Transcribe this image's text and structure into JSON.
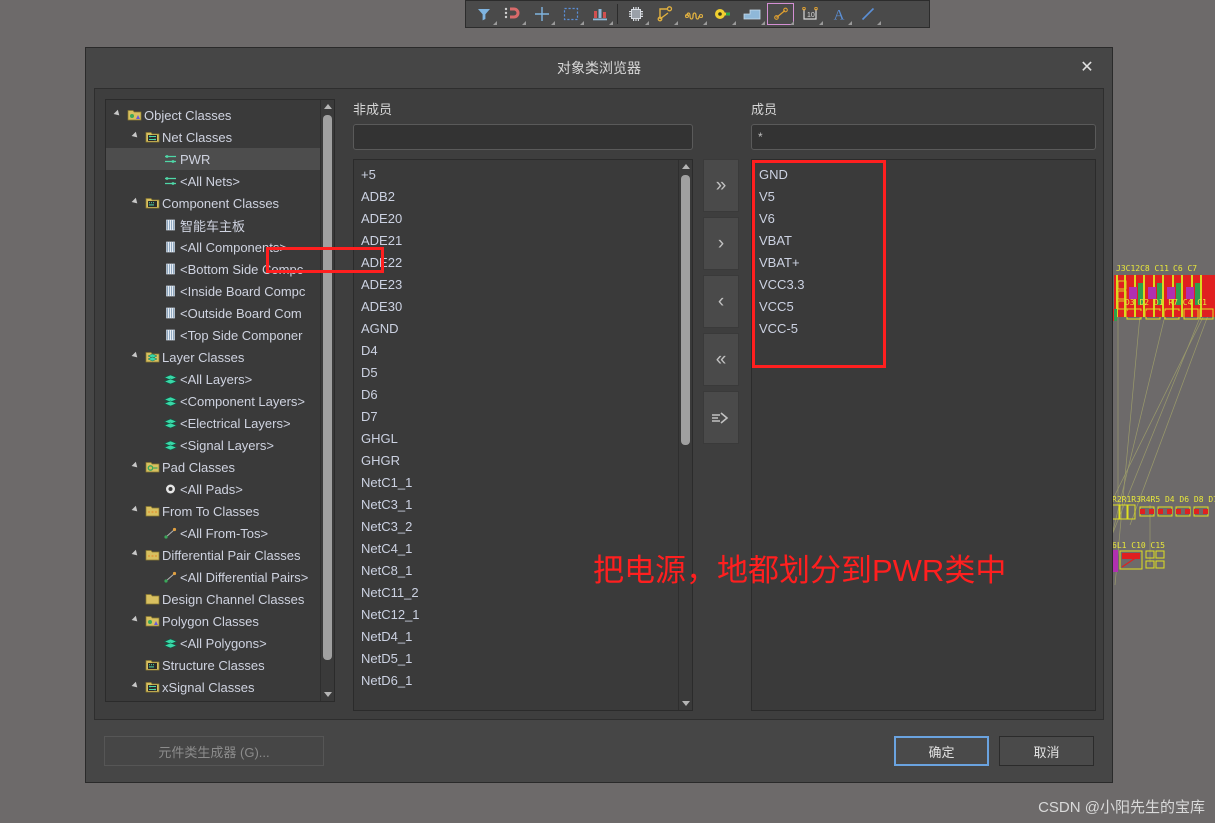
{
  "toolbar": {
    "items": [
      {
        "name": "filter-icon",
        "label": "Filter"
      },
      {
        "name": "magnet-icon",
        "label": "Snap"
      },
      {
        "name": "crosshair-icon",
        "label": "Origin"
      },
      {
        "name": "selection-rect-icon",
        "label": "Selection"
      },
      {
        "name": "board-planning-icon",
        "label": "Board Planning"
      },
      {
        "name": "component-chip-icon",
        "label": "Place Component"
      },
      {
        "name": "route-track-icon",
        "label": "Interactive Routing"
      },
      {
        "name": "squiggle-icon",
        "label": "Length Tuning"
      },
      {
        "name": "via-icon",
        "label": "Place Via"
      },
      {
        "name": "polygon-pour-icon",
        "label": "Polygon Pour"
      },
      {
        "name": "dimension-icon",
        "label": "Dimension"
      },
      {
        "name": "ruler-icon",
        "label": "Measure"
      },
      {
        "name": "text-icon",
        "label": "Place String"
      },
      {
        "name": "line-icon",
        "label": "Place Line"
      }
    ]
  },
  "dialog": {
    "title": "对象类浏览器",
    "close_label": "✕"
  },
  "tree": {
    "nodes": [
      {
        "indent": 0,
        "twisty": true,
        "icon": "object-classes-icon",
        "label": "Object Classes",
        "selected": false
      },
      {
        "indent": 1,
        "twisty": true,
        "icon": "net-classes-icon",
        "label": "Net Classes",
        "selected": false
      },
      {
        "indent": 2,
        "twisty": false,
        "icon": "net-icon",
        "label": "PWR",
        "selected": true
      },
      {
        "indent": 2,
        "twisty": false,
        "icon": "net-icon",
        "label": "<All Nets>",
        "selected": false
      },
      {
        "indent": 1,
        "twisty": true,
        "icon": "component-classes-icon",
        "label": "Component Classes",
        "selected": false
      },
      {
        "indent": 2,
        "twisty": false,
        "icon": "component-icon",
        "label": "智能车主板",
        "selected": false
      },
      {
        "indent": 2,
        "twisty": false,
        "icon": "component-icon",
        "label": "<All Components>",
        "selected": false
      },
      {
        "indent": 2,
        "twisty": false,
        "icon": "component-icon",
        "label": "<Bottom Side Compc",
        "selected": false
      },
      {
        "indent": 2,
        "twisty": false,
        "icon": "component-icon",
        "label": "<Inside Board Compc",
        "selected": false
      },
      {
        "indent": 2,
        "twisty": false,
        "icon": "component-icon",
        "label": "<Outside Board Com",
        "selected": false
      },
      {
        "indent": 2,
        "twisty": false,
        "icon": "component-icon",
        "label": "<Top Side Componer",
        "selected": false
      },
      {
        "indent": 1,
        "twisty": true,
        "icon": "layer-classes-icon",
        "label": "Layer Classes",
        "selected": false
      },
      {
        "indent": 2,
        "twisty": false,
        "icon": "layer-icon",
        "label": "<All Layers>",
        "selected": false
      },
      {
        "indent": 2,
        "twisty": false,
        "icon": "layer-icon",
        "label": "<Component Layers>",
        "selected": false
      },
      {
        "indent": 2,
        "twisty": false,
        "icon": "layer-icon",
        "label": "<Electrical Layers>",
        "selected": false
      },
      {
        "indent": 2,
        "twisty": false,
        "icon": "layer-icon",
        "label": "<Signal Layers>",
        "selected": false
      },
      {
        "indent": 1,
        "twisty": true,
        "icon": "pad-classes-icon",
        "label": "Pad Classes",
        "selected": false
      },
      {
        "indent": 2,
        "twisty": false,
        "icon": "pad-icon",
        "label": "<All Pads>",
        "selected": false
      },
      {
        "indent": 1,
        "twisty": true,
        "icon": "fromto-classes-icon",
        "label": "From To Classes",
        "selected": false
      },
      {
        "indent": 2,
        "twisty": false,
        "icon": "fromto-icon",
        "label": "<All From-Tos>",
        "selected": false
      },
      {
        "indent": 1,
        "twisty": true,
        "icon": "diffpair-classes-icon",
        "label": "Differential Pair Classes",
        "selected": false
      },
      {
        "indent": 2,
        "twisty": false,
        "icon": "diffpair-icon",
        "label": "<All Differential Pairs>",
        "selected": false
      },
      {
        "indent": 1,
        "twisty": false,
        "icon": "design-channel-icon",
        "label": "Design Channel Classes",
        "selected": false
      },
      {
        "indent": 1,
        "twisty": true,
        "icon": "polygon-classes-icon",
        "label": "Polygon Classes",
        "selected": false
      },
      {
        "indent": 2,
        "twisty": false,
        "icon": "polygon-icon",
        "label": "<All Polygons>",
        "selected": false
      },
      {
        "indent": 1,
        "twisty": false,
        "icon": "structure-classes-icon",
        "label": "Structure Classes",
        "selected": false
      },
      {
        "indent": 1,
        "twisty": true,
        "icon": "xsignal-classes-icon",
        "label": "xSignal Classes",
        "selected": false
      }
    ]
  },
  "nonmembers": {
    "title": "非成员",
    "filter_value": "",
    "filter_placeholder": "",
    "items": [
      "+5",
      "ADB2",
      "ADE20",
      "ADE21",
      "ADE22",
      "ADE23",
      "ADE30",
      "AGND",
      "D4",
      "D5",
      "D6",
      "D7",
      "GHGL",
      "GHGR",
      "NetC1_1",
      "NetC3_1",
      "NetC3_2",
      "NetC4_1",
      "NetC8_1",
      "NetC11_2",
      "NetC12_1",
      "NetD4_1",
      "NetD5_1",
      "NetD6_1"
    ]
  },
  "members": {
    "title": "成员",
    "filter_value": "*",
    "filter_placeholder": "",
    "items": [
      "GND",
      "V5",
      "V6",
      "VBAT",
      "VBAT+",
      "VCC3.3",
      "VCC5",
      "VCC-5"
    ]
  },
  "transfer": {
    "buttons": [
      {
        "name": "move-all-right-button",
        "glyph": "»"
      },
      {
        "name": "move-right-button",
        "glyph": "›"
      },
      {
        "name": "move-left-button",
        "glyph": "‹"
      },
      {
        "name": "move-all-left-button",
        "glyph": "«"
      },
      {
        "name": "create-class-button",
        "glyph": "⇒"
      }
    ]
  },
  "footer": {
    "generator_label": "元件类生成器 (G)...",
    "ok_label": "确定",
    "cancel_label": "取消"
  },
  "annotation": {
    "text": "把电源，地都划分到PWR类中",
    "color": "#ff1f1f"
  },
  "watermark": {
    "text": "CSDN @小阳先生的宝库"
  },
  "pcb_preview": {
    "labels_row1": "J3C12C8 C11    C6 C7",
    "labels_row2": "D3  D2  D1   R7  C4  C1",
    "labels_row3": "R2R1R3R4R5  D4  D6  D8  D7",
    "labels_row4": "6L1   C10 C15"
  },
  "colors": {
    "desktop": "#6d6a6a",
    "dialog": "#464646",
    "panel": "#3a3a3a",
    "text": "#ccd2e2",
    "accent_red": "#ff1f1f",
    "focus_blue": "#6aa3e0"
  }
}
